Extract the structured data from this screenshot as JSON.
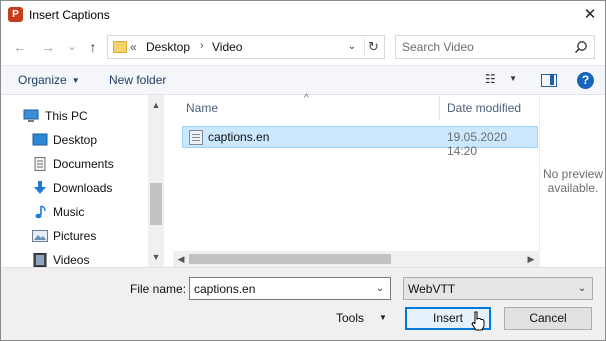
{
  "window": {
    "title": "Insert Captions",
    "app_icon_letter": "P",
    "close_glyph": "✕"
  },
  "nav": {
    "back_glyph": "←",
    "forward_glyph": "→",
    "recent_glyph": "⌄",
    "up_glyph": "↑"
  },
  "address": {
    "overflow": "«",
    "crumbs": [
      "Desktop",
      "Video"
    ],
    "separator": "›",
    "dropdown_glyph": "⌄",
    "refresh_glyph": "↻"
  },
  "search": {
    "placeholder": "Search Video"
  },
  "toolbar": {
    "organize_label": "Organize",
    "organize_arrow": "▼",
    "new_folder_label": "New folder",
    "view_glyph": "☷",
    "view_arrow": "▼",
    "help_glyph": "?"
  },
  "sidebar": {
    "items": [
      {
        "label": "This PC",
        "icon": "this-pc-icon"
      },
      {
        "label": "Desktop",
        "icon": "desktop-icon"
      },
      {
        "label": "Documents",
        "icon": "documents-icon"
      },
      {
        "label": "Downloads",
        "icon": "downloads-icon"
      },
      {
        "label": "Music",
        "icon": "music-icon"
      },
      {
        "label": "Pictures",
        "icon": "pictures-icon"
      },
      {
        "label": "Videos",
        "icon": "videos-icon"
      }
    ]
  },
  "filelist": {
    "columns": [
      "Name",
      "Date modified"
    ],
    "sort_caret": "^",
    "rows": [
      {
        "name": "captions.en",
        "date": "19.05.2020 14:20",
        "selected": true
      }
    ]
  },
  "preview": {
    "text_line1": "No preview",
    "text_line2": "available."
  },
  "bottom": {
    "file_name_label": "File name:",
    "file_name_value": "captions.en",
    "file_type_value": "WebVTT",
    "tools_label": "Tools",
    "tools_arrow": "▼",
    "insert_label": "Insert",
    "cancel_label": "Cancel"
  },
  "colors": {
    "selection_bg": "#cce8ff",
    "accent_blue": "#0078d7",
    "toolbar_text": "#1f3e68"
  }
}
